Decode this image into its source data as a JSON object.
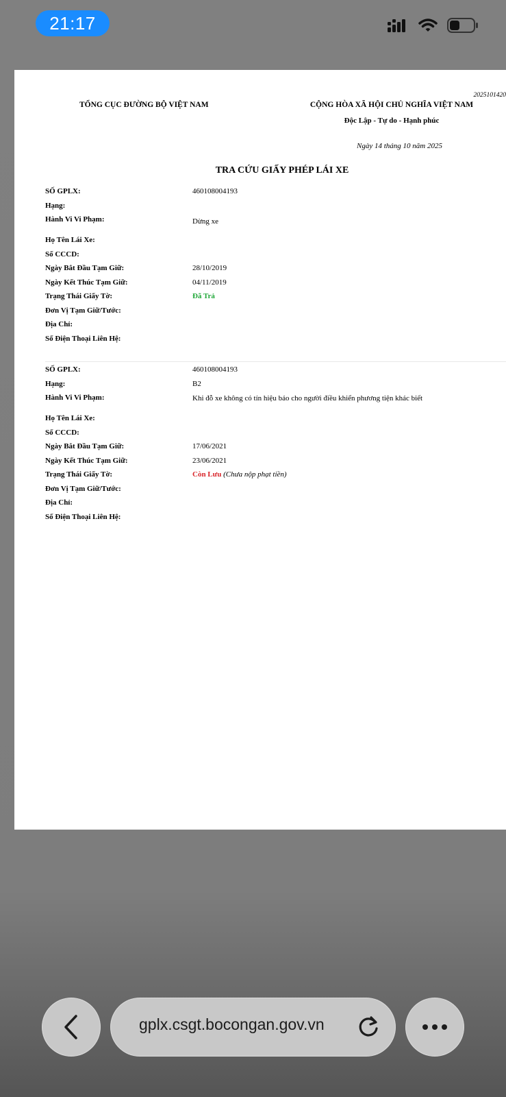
{
  "status_bar": {
    "time": "21:17"
  },
  "document": {
    "code": "2025101420",
    "org_left": "TỔNG CỤC ĐƯỜNG BỘ VIỆT NAM",
    "org_right": "CỘNG HÒA XÃ HỘI CHỦ NGHĨA VIỆT NAM",
    "motto": "Độc Lập - Tự do - Hạnh phúc",
    "date": "Ngày 14 tháng 10 năm 2025",
    "title": "TRA CỨU GIẤY PHÉP LÁI XE",
    "labels": {
      "license_no": "SỐ GPLX:",
      "class": "Hạng:",
      "violation": "Hành Vi Vi Phạm:",
      "driver_name": "Họ Tên Lái Xe:",
      "id_no": "Số CCCD:",
      "hold_start": "Ngày Bắt Đầu Tạm Giữ:",
      "hold_end": "Ngày Kết Thúc Tạm Giữ:",
      "doc_status": "Trạng Thái Giấy Tờ:",
      "unit": "Đơn Vị Tạm Giữ/Tước:",
      "address": "Địa Chỉ:",
      "phone": "Số Điện Thoại Liên Hệ:"
    },
    "records": [
      {
        "license_no": "460108004193",
        "class": "",
        "violation": "Dừng xe",
        "driver_name": "",
        "id_no": "",
        "hold_start": "28/10/2019",
        "hold_end": "04/11/2019",
        "doc_status": "Đã Trả",
        "doc_status_note": "",
        "unit": "",
        "address": "",
        "phone": ""
      },
      {
        "license_no": "460108004193",
        "class": "B2",
        "violation": "Khi đỗ xe không có tín hiệu báo cho người điều khiển phương tiện khác biết",
        "driver_name": "",
        "id_no": "",
        "hold_start": "17/06/2021",
        "hold_end": "23/06/2021",
        "doc_status": "Còn Lưu",
        "doc_status_note": "(Chưa nộp phạt tiền)",
        "unit": "",
        "address": "",
        "phone": ""
      }
    ]
  },
  "browser": {
    "url": "gplx.csgt.bocongan.gov.vn"
  },
  "colors": {
    "status_returned": "#22a83a",
    "status_held": "#d9262b",
    "time_pill": "#1a8cff"
  },
  "icons": [
    "signal-icon",
    "wifi-icon",
    "battery-icon",
    "back-chevron-icon",
    "reload-icon",
    "more-icon"
  ]
}
